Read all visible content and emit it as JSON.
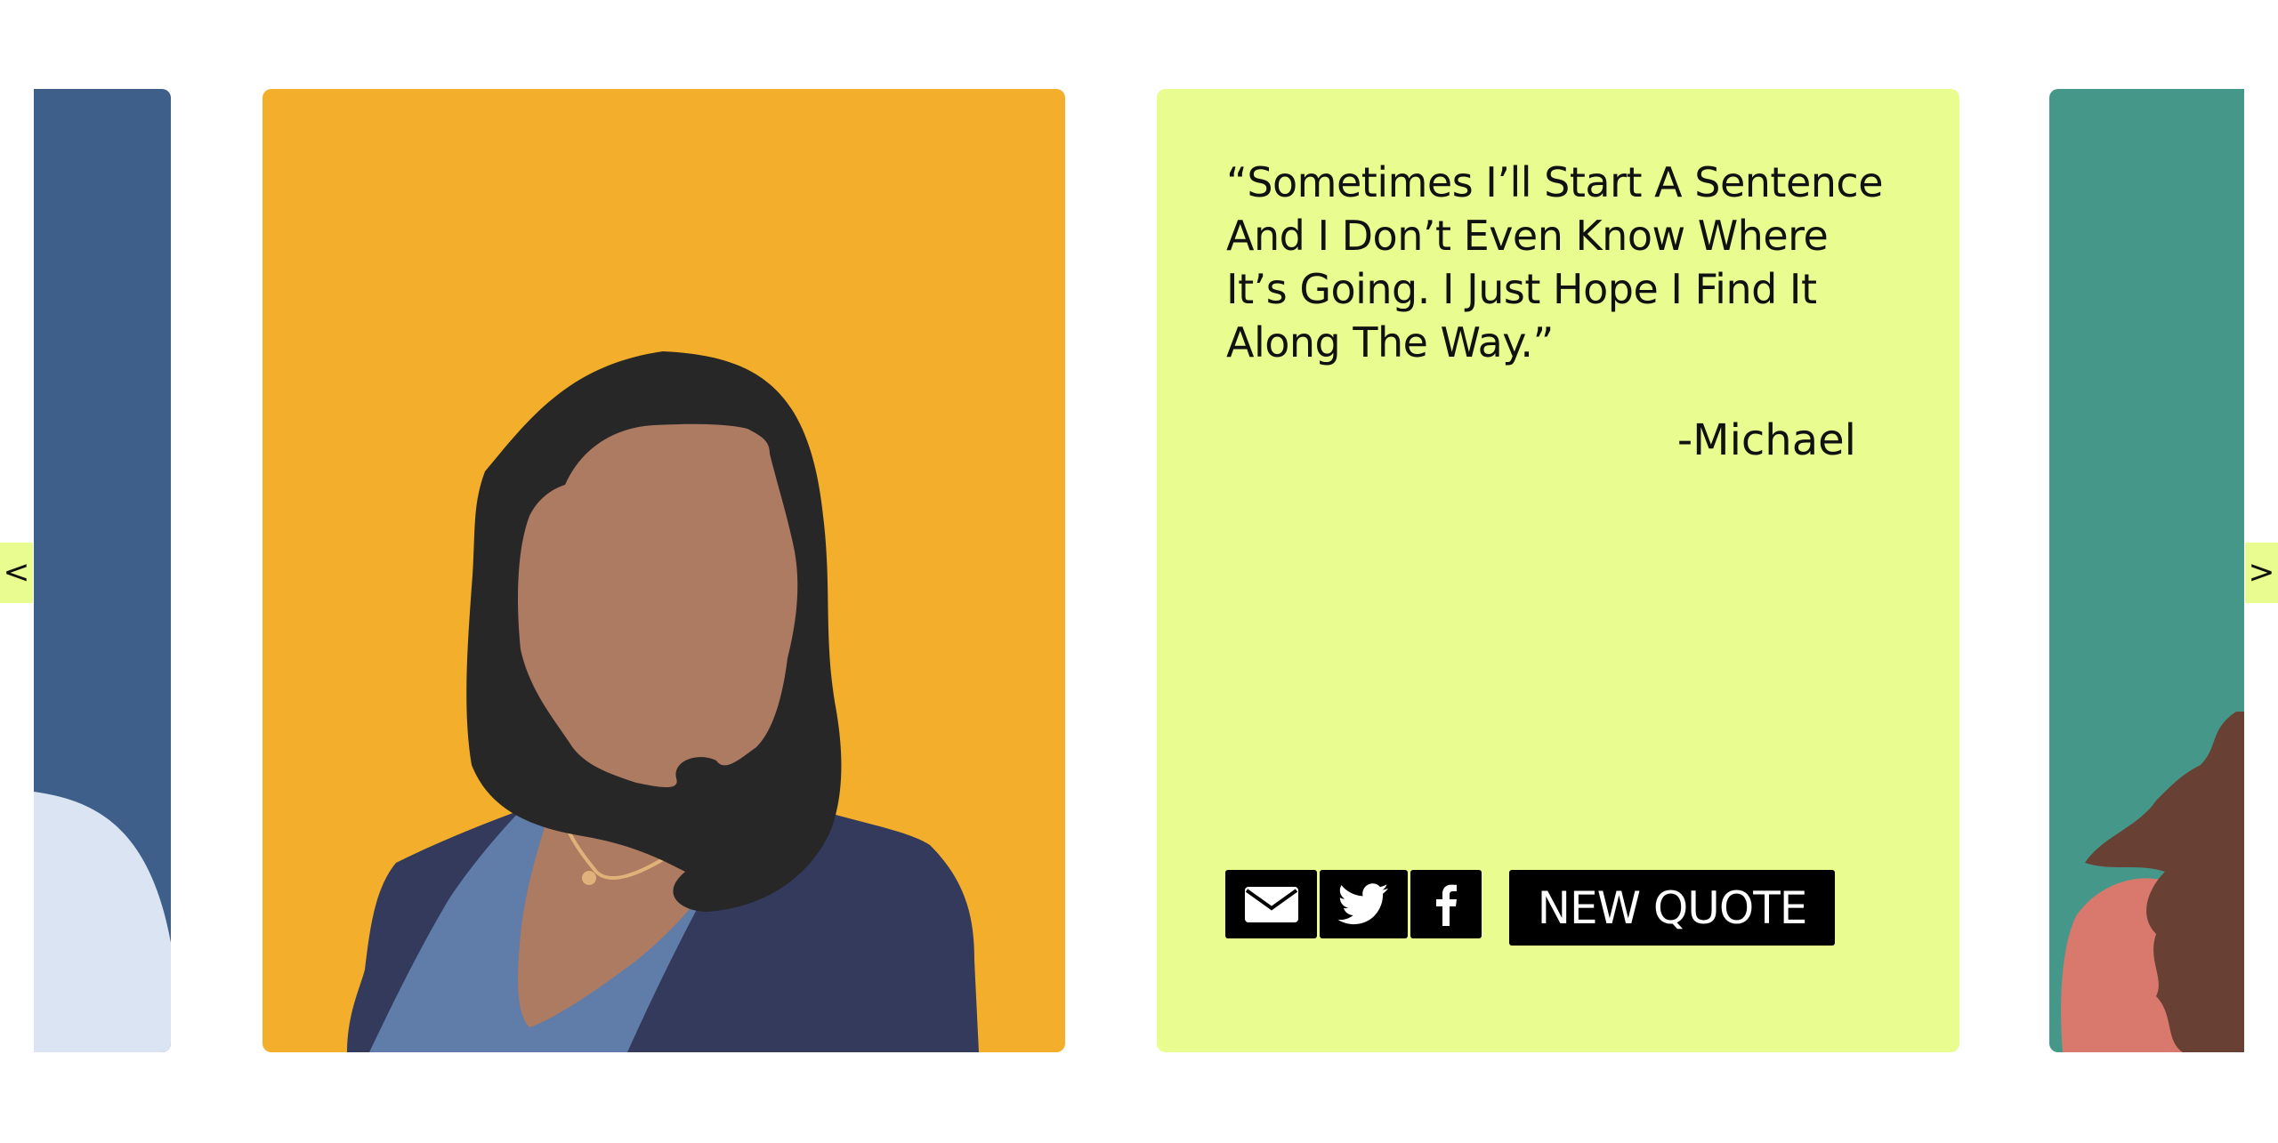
{
  "carousel": {
    "prev_label": "<",
    "next_label": ">"
  },
  "quote": {
    "text": "“Sometimes I’ll Start A Sentence And I Don’t Even Know Where It’s Going. I Just Hope I Find It Along The Way.”",
    "author": "-Michael"
  },
  "actions": {
    "email_icon": "envelope-icon",
    "twitter_icon": "twitter-bird-icon",
    "facebook_icon": "facebook-f-icon",
    "new_quote_label": "NEW QUOTE"
  },
  "colors": {
    "left_card": "#3e5f8a",
    "portrait_card": "#f3ae2b",
    "quote_card": "#e9fc8f",
    "right_card": "#45978a",
    "hair": "#272727",
    "skin": "#ad7a62",
    "jacket": "#343a5c",
    "shirt": "#607ca8"
  }
}
